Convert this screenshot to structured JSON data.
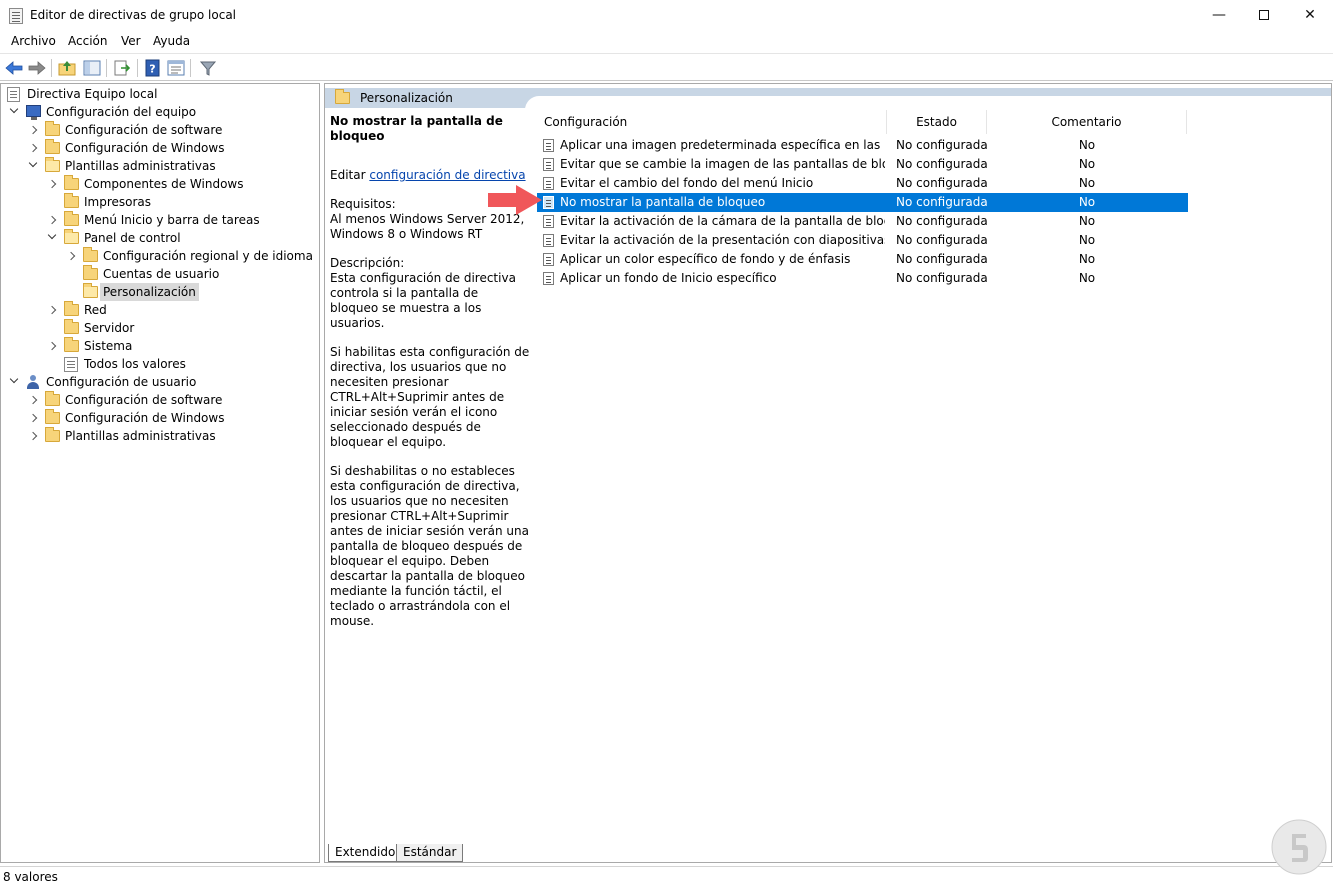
{
  "window": {
    "title": "Editor de directivas de grupo local"
  },
  "menubar": {
    "items": [
      "Archivo",
      "Acción",
      "Ver",
      "Ayuda"
    ]
  },
  "tree": {
    "root": "Directiva Equipo local",
    "items": [
      "Configuración del equipo",
      "Configuración de software",
      "Configuración de Windows",
      "Plantillas administrativas",
      "Componentes de Windows",
      "Impresoras",
      "Menú Inicio y barra de tareas",
      "Panel de control",
      "Configuración regional y de idioma",
      "Cuentas de usuario",
      "Personalización",
      "Red",
      "Servidor",
      "Sistema",
      "Todos los valores",
      "Configuración de usuario",
      "Configuración de software",
      "Configuración de Windows",
      "Plantillas administrativas"
    ]
  },
  "header": {
    "title": "Personalización"
  },
  "description": {
    "title": "No mostrar la pantalla de bloqueo",
    "edit_prefix": "Editar ",
    "edit_link": "configuración de directiva",
    "requirements": "Requisitos:\nAl menos Windows Server 2012, Windows 8 o Windows RT",
    "desc_p1": "Descripción:\nEsta configuración de directiva controla si la pantalla de bloqueo se muestra a los usuarios.",
    "desc_p2": "Si habilitas esta configuración de directiva, los usuarios que no necesiten presionar CTRL+Alt+Suprimir antes de iniciar sesión verán el icono seleccionado después de bloquear el equipo.",
    "desc_p3": "Si deshabilitas o no estableces esta configuración de directiva, los usuarios que no necesiten presionar CTRL+Alt+Suprimir antes de iniciar sesión verán una pantalla de bloqueo después de bloquear el equipo. Deben descartar la pantalla de bloqueo mediante la función táctil, el teclado o arrastrándola con el mouse."
  },
  "table": {
    "columns": [
      "Configuración",
      "Estado",
      "Comentario"
    ],
    "rows": [
      {
        "setting": "Aplicar una imagen predeterminada específica en las pantall...",
        "state": "No configurada",
        "comment": "No"
      },
      {
        "setting": "Evitar que se cambie la imagen de las pantallas de bloqueo ...",
        "state": "No configurada",
        "comment": "No"
      },
      {
        "setting": "Evitar el cambio del fondo del menú Inicio",
        "state": "No configurada",
        "comment": "No"
      },
      {
        "setting": "No mostrar la pantalla de bloqueo",
        "state": "No configurada",
        "comment": "No"
      },
      {
        "setting": "Evitar la activación de la cámara de la pantalla de bloqueo",
        "state": "No configurada",
        "comment": "No"
      },
      {
        "setting": "Evitar la activación de la presentación con diapositivas de la ...",
        "state": "No configurada",
        "comment": "No"
      },
      {
        "setting": "Aplicar un color específico de fondo y de énfasis",
        "state": "No configurada",
        "comment": "No"
      },
      {
        "setting": "Aplicar un fondo de Inicio específico",
        "state": "No configurada",
        "comment": "No"
      }
    ],
    "selected_index": 3
  },
  "tabs": [
    "Extendido",
    "Estándar"
  ],
  "status": {
    "text": "8 valores"
  },
  "colors": {
    "selection": "#0078d7",
    "header_band": "#c8d6e5",
    "arrow": "#f0575a"
  }
}
